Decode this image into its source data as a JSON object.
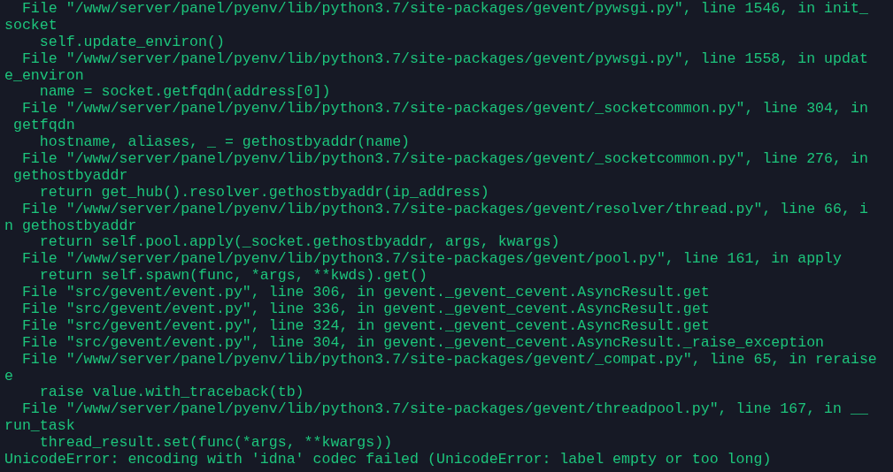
{
  "terminal": {
    "lines": [
      "  File \"/www/server/panel/pyenv/lib/python3.7/site-packages/gevent/pywsgi.py\", line 1546, in init_",
      "socket",
      "    self.update_environ()",
      "  File \"/www/server/panel/pyenv/lib/python3.7/site-packages/gevent/pywsgi.py\", line 1558, in updat",
      "e_environ",
      "    name = socket.getfqdn(address[0])",
      "  File \"/www/server/panel/pyenv/lib/python3.7/site-packages/gevent/_socketcommon.py\", line 304, in",
      " getfqdn",
      "    hostname, aliases, _ = gethostbyaddr(name)",
      "  File \"/www/server/panel/pyenv/lib/python3.7/site-packages/gevent/_socketcommon.py\", line 276, in",
      " gethostbyaddr",
      "    return get_hub().resolver.gethostbyaddr(ip_address)",
      "  File \"/www/server/panel/pyenv/lib/python3.7/site-packages/gevent/resolver/thread.py\", line 66, i",
      "n gethostbyaddr",
      "    return self.pool.apply(_socket.gethostbyaddr, args, kwargs)",
      "  File \"/www/server/panel/pyenv/lib/python3.7/site-packages/gevent/pool.py\", line 161, in apply",
      "    return self.spawn(func, *args, **kwds).get()",
      "  File \"src/gevent/event.py\", line 306, in gevent._gevent_cevent.AsyncResult.get",
      "  File \"src/gevent/event.py\", line 336, in gevent._gevent_cevent.AsyncResult.get",
      "  File \"src/gevent/event.py\", line 324, in gevent._gevent_cevent.AsyncResult.get",
      "  File \"src/gevent/event.py\", line 304, in gevent._gevent_cevent.AsyncResult._raise_exception",
      "  File \"/www/server/panel/pyenv/lib/python3.7/site-packages/gevent/_compat.py\", line 65, in reraise",
      "e",
      "    raise value.with_traceback(tb)",
      "  File \"/www/server/panel/pyenv/lib/python3.7/site-packages/gevent/threadpool.py\", line 167, in __",
      "run_task",
      "    thread_result.set(func(*args, **kwargs))",
      "UnicodeError: encoding with 'idna' codec failed (UnicodeError: label empty or too long)"
    ]
  }
}
